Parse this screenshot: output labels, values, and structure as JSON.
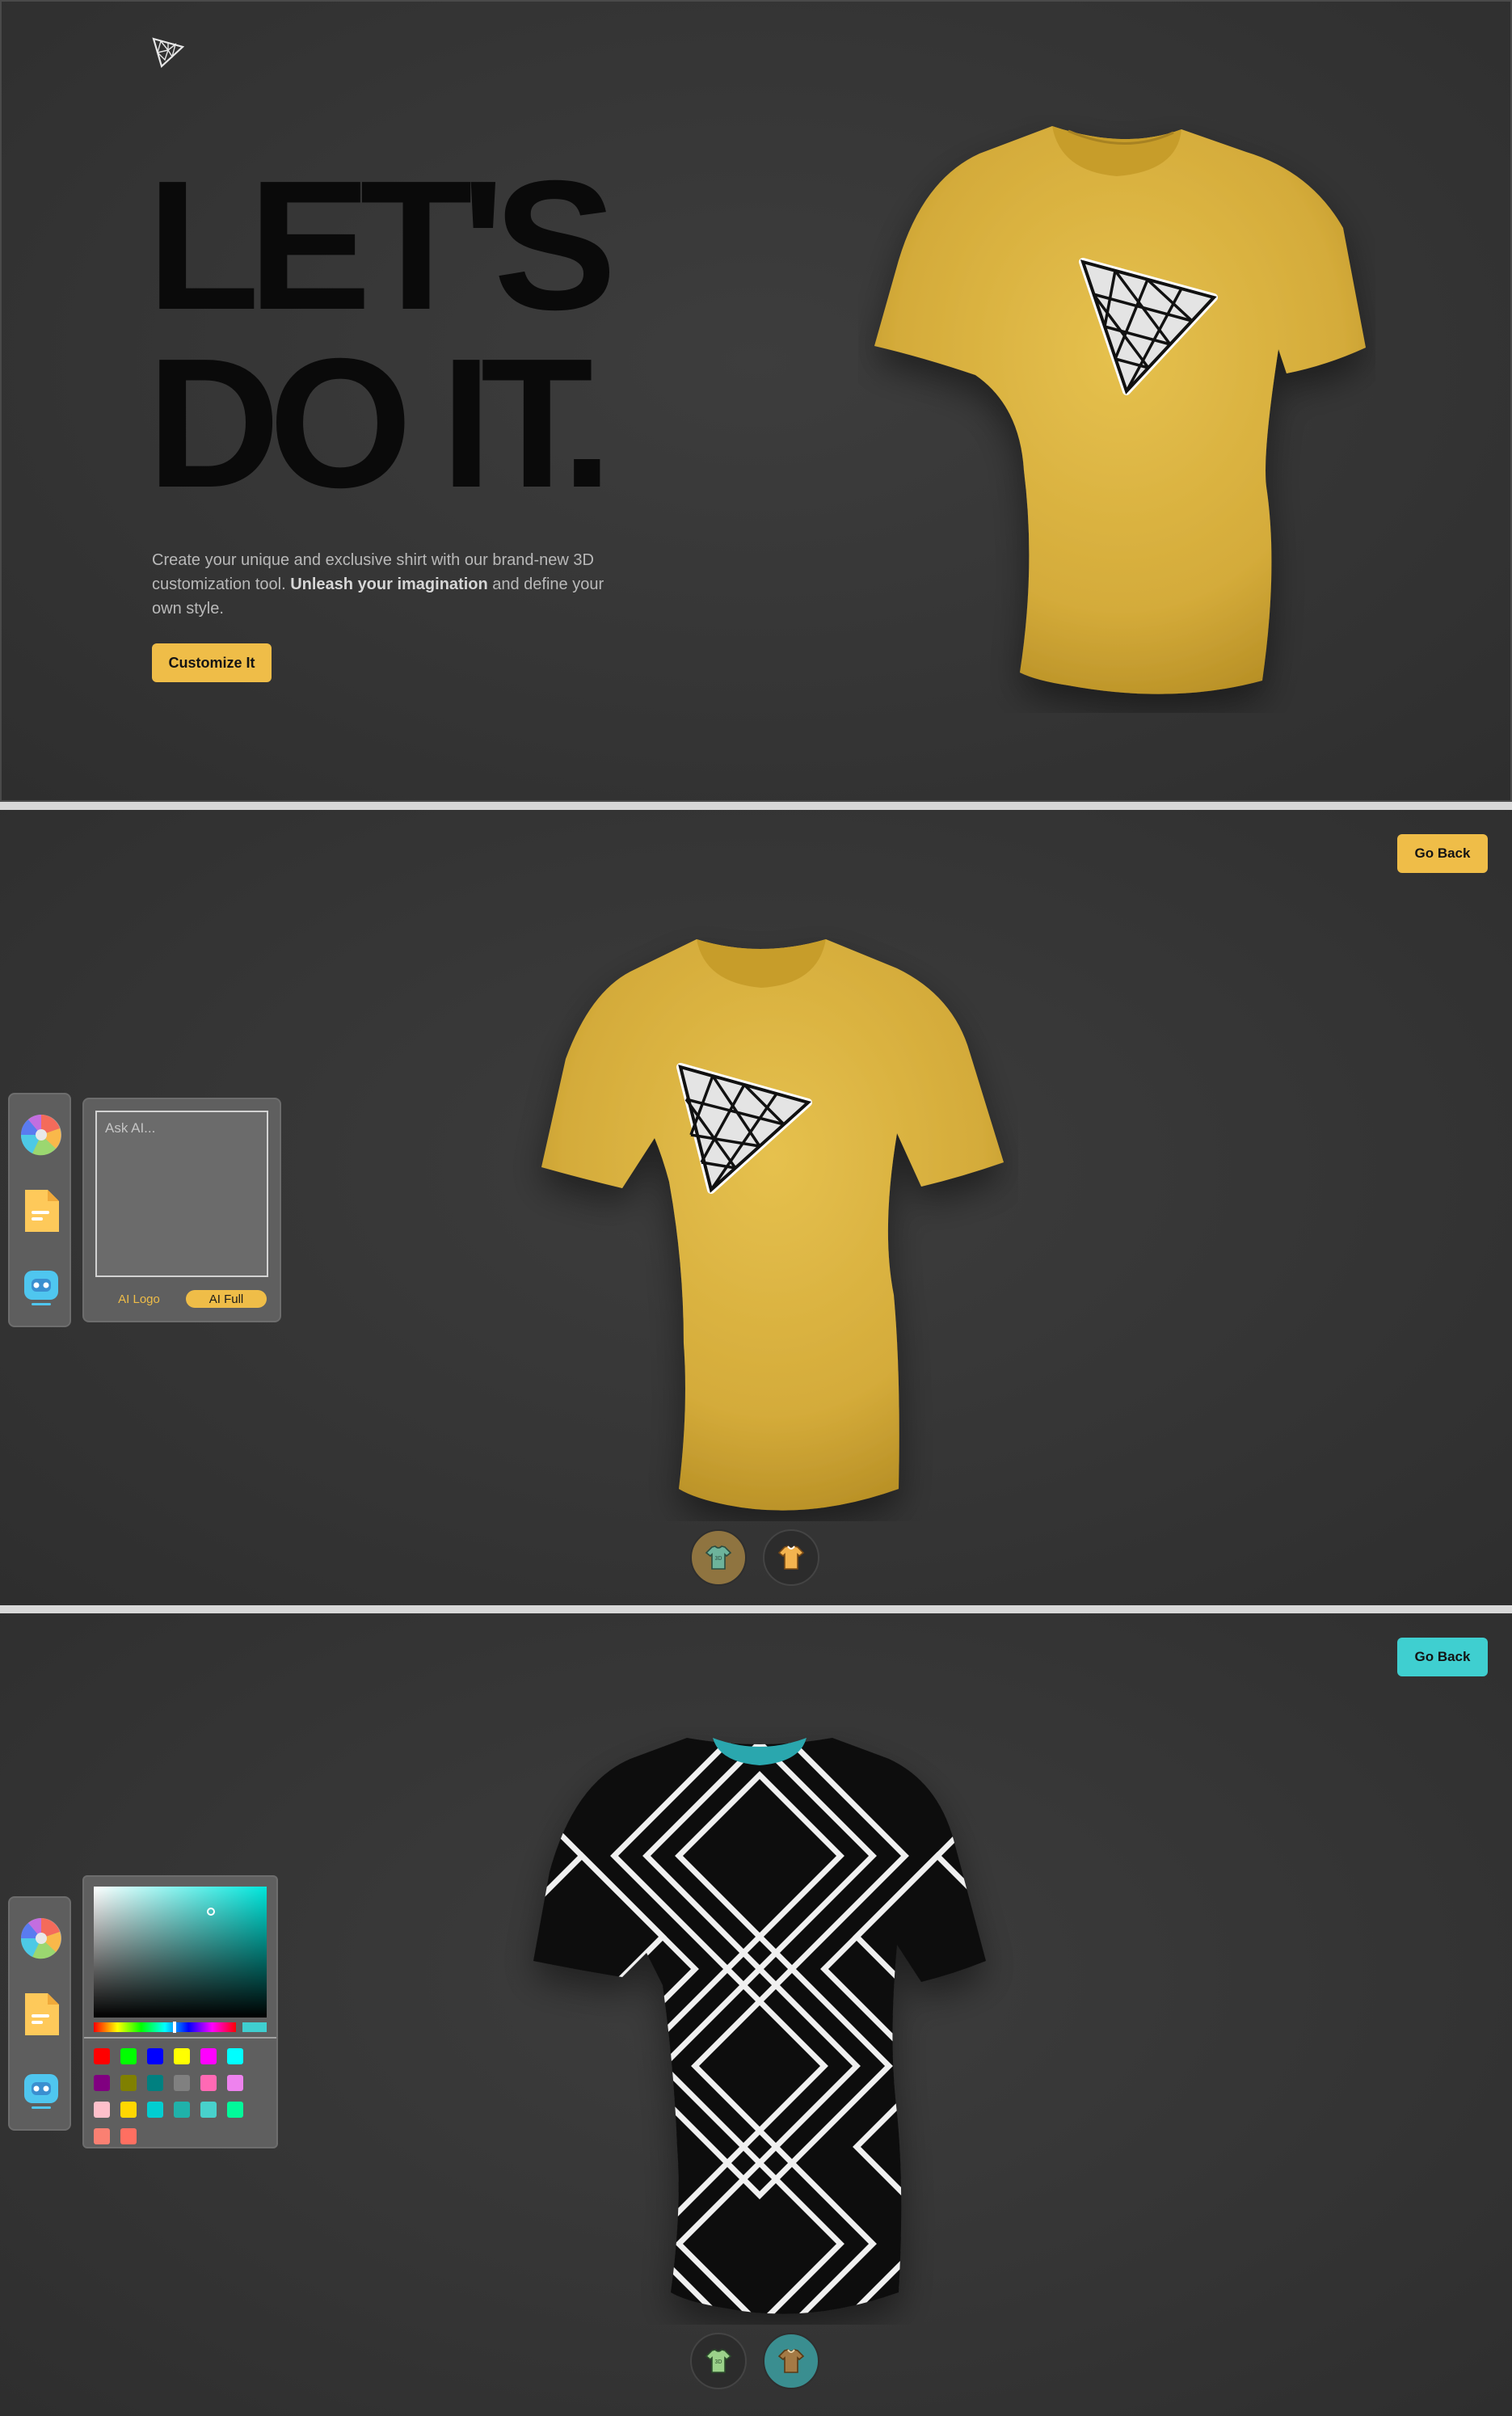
{
  "landing": {
    "headline_line1": "LET'S",
    "headline_line2": "DO IT.",
    "intro_part1": "Create your unique and exclusive shirt with our brand-new 3D customization tool. ",
    "intro_bold": "Unleash your imagination",
    "intro_part2": " and define your own style.",
    "customize_label": "Customize It",
    "accent_color": "#EFBD48"
  },
  "customizer_ai": {
    "go_back_label": "Go Back",
    "go_back_color": "#EFBD48",
    "shirt_color": "#E1BA48",
    "ai_placeholder": "Ask AI...",
    "ai_logo_label": "AI Logo",
    "ai_full_label": "AI Full",
    "sidebar_tools": [
      "color-picker-icon",
      "file-picker-icon",
      "ai-picker-icon"
    ],
    "filter_tabs": [
      {
        "name": "logo-shirt-icon",
        "active": true
      },
      {
        "name": "stylish-shirt-icon",
        "active": false
      }
    ]
  },
  "customizer_color": {
    "go_back_label": "Go Back",
    "go_back_color": "#3FCFD0",
    "shirt_pattern": "black with white diamond lines",
    "collar_color": "#2AA7AE",
    "selected_color": "#3FCFD0",
    "swatches": [
      "#ff0000",
      "#00ff00",
      "#0000ff",
      "#ffff00",
      "#ff00ff",
      "#00ffff",
      "#800080",
      "#808000",
      "#008080",
      "#808080",
      "#ff69b4",
      "#ee82ee",
      "#ffc0cb",
      "#ffd700",
      "#00ced1",
      "#20b2aa",
      "#48d1cc",
      "#00fa9a",
      "#fa8072",
      "#ff6f61"
    ],
    "filter_tabs": [
      {
        "name": "logo-shirt-icon",
        "active": false
      },
      {
        "name": "stylish-shirt-icon",
        "active": true
      }
    ]
  }
}
